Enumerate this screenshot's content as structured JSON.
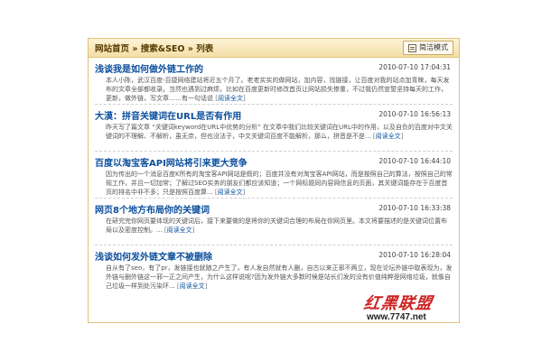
{
  "breadcrumb": {
    "home": "网站首页",
    "sep1": "»",
    "category": "搜索&SEO",
    "sep2": "»",
    "current": "列表"
  },
  "mode_button": {
    "label": "简洁模式",
    "icon": "list-icon"
  },
  "articles": [
    {
      "title": "浅谈我是如何做外链工作的",
      "time": "2010-07-10 17:04:31",
      "excerpt": "本人小陈，武汉百度-百捷网络建站将近五个月了。老老实实的做网站，加内容，找链接，让百度对我的站点加青睐，每天发布的文章全部都收录。当然也遇到过麻烦，比如在百度更新时修改首页让网站损失惨重，不过我仍然宣誓坚持每天的工作，更新，做外链，写文章……有一句话说",
      "more": "阅读全文"
    },
    {
      "title": "大漠：拼音关键词在URL是否有作用",
      "time": "2010-07-10 16:56:13",
      "excerpt": "昨天写了篇文章 “关键词keyword在URL中优势的分析” 在文章中我们比较关键词在URL中的作用，以及自负的百度对中文关键词的不理解、不解析，虽无奈，但也没法子，中文关键词百度不能解析，那么，拼音是不是...",
      "more": "阅读全文"
    },
    {
      "title": "百度以淘宝客API网站将引来更大竞争",
      "time": "2010-07-10 16:44:10",
      "excerpt": "因为传出的一个消息百度K所有的淘宝客API网站是假的；百度并没有对淘宝客API网站，而是按照自己的算法，按照自己的常规工作，并且一切加常；了解过SEO实务的朋友们都应该知道；一个网标题同内容网信息的页面，其关键词能存在于百度首页的排名中非不多；只是按照百度算...",
      "more": "阅读全文"
    },
    {
      "title": "网页8个地方布局你的关键词",
      "time": "2010-07-10 16:33:38",
      "excerpt": "在研究完你网页要体现的关键词后，接下来要做的是将你的关键词合理的布局在你网页里。本文将要描述的是关键词位置布局以及密度控制。...",
      "more": "阅读全文"
    },
    {
      "title": "浅谈如何发外链文章不被删除",
      "time": "2010-07-10 16:28:04",
      "excerpt": "自从有了seo，有了pr，发链接也就随之产生了，有人发自然就有人删，自古以来正邪不两立，现在论坛外链中取表现为，发外链与删外链这一邪一正之间产生，为什么这样说呢?因为发外链大多数时候是站长们发的没有价值纯粹是网络垃圾，就像自己垃圾一样到处污染环...",
      "more": "阅读全文"
    }
  ],
  "watermark": {
    "top": "红黑联盟",
    "bottom": "www.7747.net"
  },
  "colors": {
    "title": "#0b4f9c",
    "header_bg": "#f4dfa6",
    "border": "#e2c07a",
    "watermark": "#cc2222"
  }
}
